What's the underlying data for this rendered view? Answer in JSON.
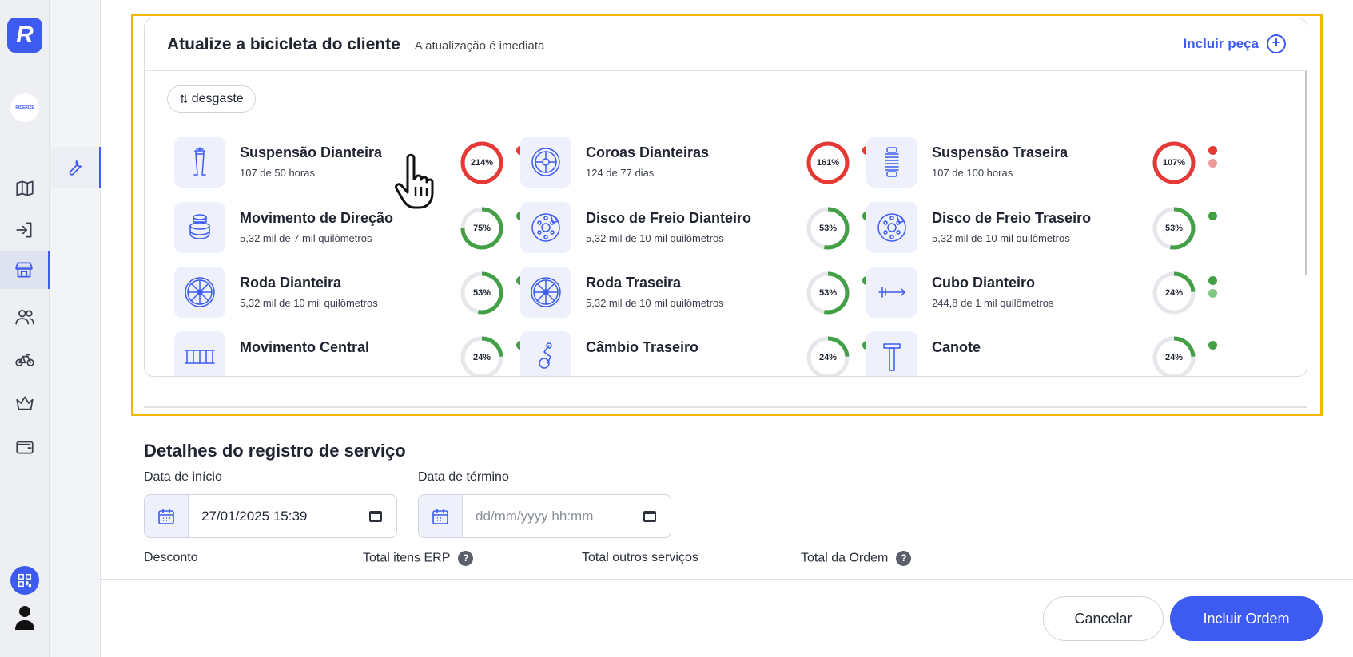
{
  "app": {
    "logo_letter": "R",
    "brand_text": "RIDERIZE"
  },
  "sidebar": {
    "items": [
      {
        "icon": "map-icon",
        "active": false
      },
      {
        "icon": "login-icon",
        "active": false
      },
      {
        "icon": "store-icon",
        "active": true
      },
      {
        "icon": "users-icon",
        "active": false
      },
      {
        "icon": "bike-icon",
        "active": false
      },
      {
        "icon": "crown-icon",
        "active": false
      },
      {
        "icon": "wallet-icon",
        "active": false
      }
    ],
    "bottom": [
      "qr-code-icon",
      "user-profile-icon"
    ]
  },
  "subnav": {
    "items": [
      {
        "icon": "wrench-icon",
        "active": true
      }
    ]
  },
  "bike_card": {
    "title": "Atualize a bicicleta do cliente",
    "subtitle": "A atualização é imediata",
    "add_part_label": "Incluir peça",
    "sort_label": "desgaste",
    "sort_icon": "sort-arrows-icon",
    "parts": [
      {
        "name": "Suspensão Dianteira",
        "meta": "107 de 50 horas",
        "percent": "214%",
        "level": 1.0,
        "status": "danger",
        "icon": "front-fork-icon",
        "dots": [
          "#e53935"
        ]
      },
      {
        "name": "Coroas Dianteiras",
        "meta": "124 de 77 dias",
        "percent": "161%",
        "level": 1.0,
        "status": "danger",
        "icon": "chainring-icon",
        "dots": [
          "#e53935"
        ]
      },
      {
        "name": "Suspensão Traseira",
        "meta": "107 de 100 horas",
        "percent": "107%",
        "level": 1.0,
        "status": "danger",
        "icon": "rear-shock-icon",
        "dots": [
          "#e53935",
          "#ef9a9a"
        ]
      },
      {
        "name": "Movimento de Direção",
        "meta": "5,32 mil de 7 mil quilômetros",
        "percent": "75%",
        "level": 0.75,
        "status": "ok",
        "icon": "headset-icon",
        "dots": [
          "#43a047"
        ]
      },
      {
        "name": "Disco de Freio Dianteiro",
        "meta": "5,32 mil de 10 mil quilômetros",
        "percent": "53%",
        "level": 0.53,
        "status": "ok",
        "icon": "brake-disc-icon",
        "dots": [
          "#43a047"
        ]
      },
      {
        "name": "Disco de Freio Traseiro",
        "meta": "5,32 mil de 10 mil quilômetros",
        "percent": "53%",
        "level": 0.53,
        "status": "ok",
        "icon": "brake-disc-icon",
        "dots": [
          "#43a047"
        ]
      },
      {
        "name": "Roda Dianteira",
        "meta": "5,32 mil de 10 mil quilômetros",
        "percent": "53%",
        "level": 0.53,
        "status": "ok",
        "icon": "wheel-icon",
        "dots": [
          "#43a047"
        ]
      },
      {
        "name": "Roda Traseira",
        "meta": "5,32 mil de 10 mil quilômetros",
        "percent": "53%",
        "level": 0.53,
        "status": "ok",
        "icon": "wheel-icon",
        "dots": [
          "#43a047"
        ]
      },
      {
        "name": "Cubo Dianteiro",
        "meta": "244,8 de 1 mil quilômetros",
        "percent": "24%",
        "level": 0.24,
        "status": "ok",
        "icon": "hub-icon",
        "dots": [
          "#43a047",
          "#81c784"
        ]
      },
      {
        "name": "Movimento Central",
        "meta": "",
        "percent": "24%",
        "level": 0.24,
        "status": "ok",
        "icon": "bottom-bracket-icon",
        "dots": [
          "#43a047"
        ]
      },
      {
        "name": "Câmbio Traseiro",
        "meta": "",
        "percent": "24%",
        "level": 0.24,
        "status": "ok",
        "icon": "derailleur-icon",
        "dots": [
          "#43a047"
        ]
      },
      {
        "name": "Canote",
        "meta": "",
        "percent": "24%",
        "level": 0.24,
        "status": "ok",
        "icon": "seatpost-icon",
        "dots": [
          "#43a047"
        ]
      }
    ]
  },
  "details": {
    "title": "Detalhes do registro de serviço",
    "start_label": "Data de início",
    "start_value": "27/01/2025 15:39",
    "end_label": "Data de término",
    "end_placeholder": "dd/mm/yyyy hh:mm",
    "discount_label": "Desconto",
    "erp_label": "Total itens ERP",
    "other_label": "Total outros serviços",
    "order_total_label": "Total da Ordem"
  },
  "footer": {
    "cancel_label": "Cancelar",
    "submit_label": "Incluir Ordem"
  },
  "colors": {
    "accent": "#3d5bf0",
    "danger": "#e53935",
    "ok": "#43a047",
    "highlight": "#f2b705"
  }
}
